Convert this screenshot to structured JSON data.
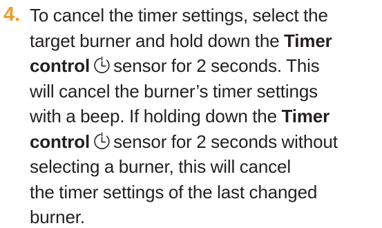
{
  "step": {
    "number": "4.",
    "accent_color": "#f39a26",
    "icon": "timer-icon",
    "lines": {
      "l1": "To cancel the timer settings, select the",
      "l2a": "target burner and hold down the",
      "l2b": "Timer",
      "l3a": "control",
      "l3b": "sensor for 2 seconds. This",
      "l4": "will cancel the burner’s timer settings",
      "l5a": "with a beep. If holding down the",
      "l5b": "Timer",
      "l6a": "control",
      "l6b": "sensor for 2 seconds without",
      "l7": "selecting a burner, this will cancel",
      "l8": "the timer settings of the last changed",
      "l9": "burner."
    }
  }
}
